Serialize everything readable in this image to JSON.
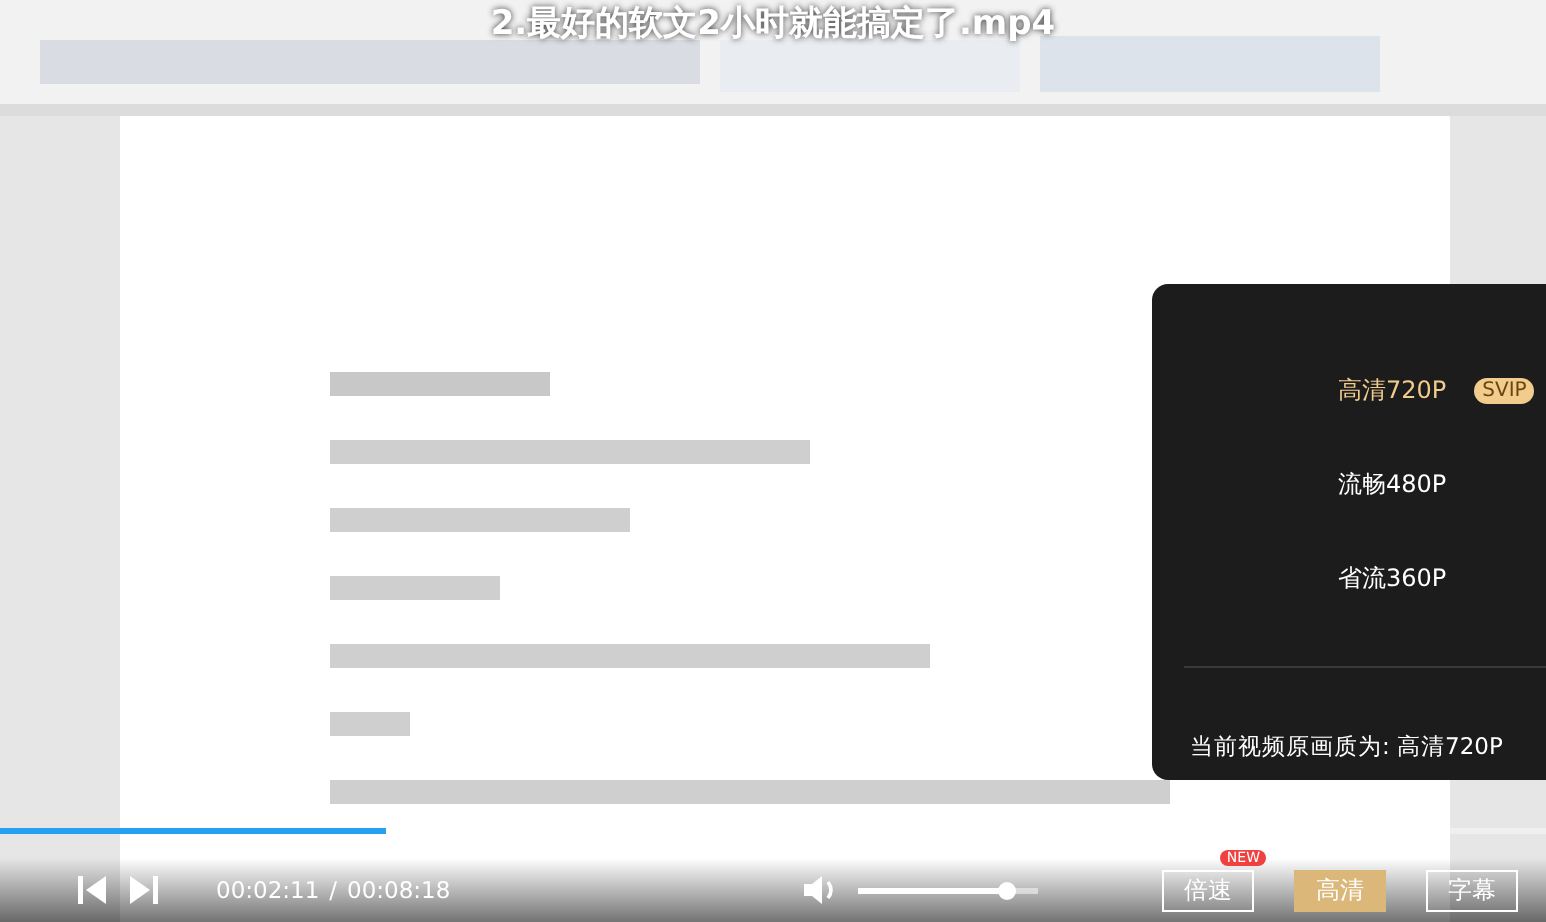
{
  "video": {
    "title": "2.最好的软文2小时就能搞定了.mp4",
    "kind": "picture"
  },
  "quality_menu": {
    "options": [
      {
        "label": "高清720P",
        "badge": "SVIP",
        "selected": true
      },
      {
        "label": "流畅480P",
        "selected": false
      },
      {
        "label": "省流360P",
        "selected": false
      }
    ],
    "note": "当前视频原画质为: 高清720P"
  },
  "progress": {
    "level": 0.25
  },
  "controls": {
    "current_time": "00:02:11",
    "separator": "/",
    "duration": "00:08:18",
    "volume": {
      "level": 0.82
    },
    "buttons": [
      {
        "label": "倍速",
        "badge": "NEW",
        "selected": false
      },
      {
        "label": "高清",
        "selected": true
      },
      {
        "label": "字幕",
        "selected": false
      }
    ]
  }
}
